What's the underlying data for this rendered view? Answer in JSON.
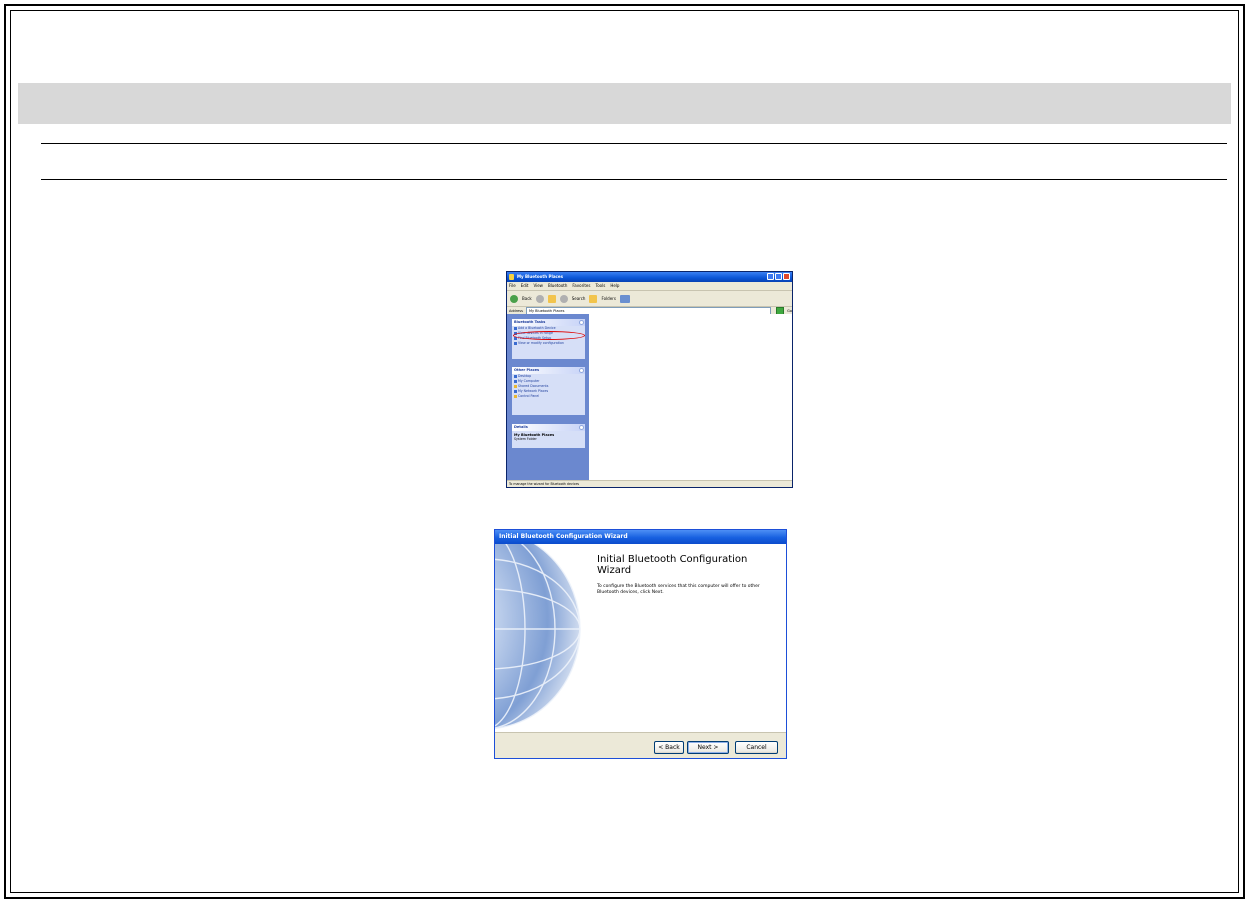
{
  "explorer": {
    "title": "My Bluetooth Places",
    "menu": [
      "File",
      "Edit",
      "View",
      "Bluetooth",
      "Favorites",
      "Tools",
      "Help"
    ],
    "toolbar": {
      "back": "Back",
      "search": "Search",
      "folders": "Folders"
    },
    "address_label": "Address",
    "address_value": "My Bluetooth Places",
    "go_label": "Go",
    "tasks_panel": {
      "header": "Bluetooth Tasks",
      "items": [
        "Add a Bluetooth Device",
        "View devices in range",
        "Find Bluetooth Setup",
        "View or modify configuration"
      ]
    },
    "other_places": {
      "header": "Other Places",
      "items": [
        "Desktop",
        "My Computer",
        "Shared Documents",
        "My Network Places",
        "Control Panel"
      ]
    },
    "details": {
      "header": "Details",
      "name": "My Bluetooth Places",
      "sub": "System Folder"
    },
    "status": "To manage the wizard for Bluetooth devices"
  },
  "wizard": {
    "title": "Initial Bluetooth Configuration Wizard",
    "heading": "Initial Bluetooth Configuration Wizard",
    "description": "To configure the Bluetooth services that this computer will offer to other Bluetooth devices, click Next.",
    "buttons": {
      "back": "< Back",
      "next": "Next >",
      "cancel": "Cancel"
    }
  }
}
